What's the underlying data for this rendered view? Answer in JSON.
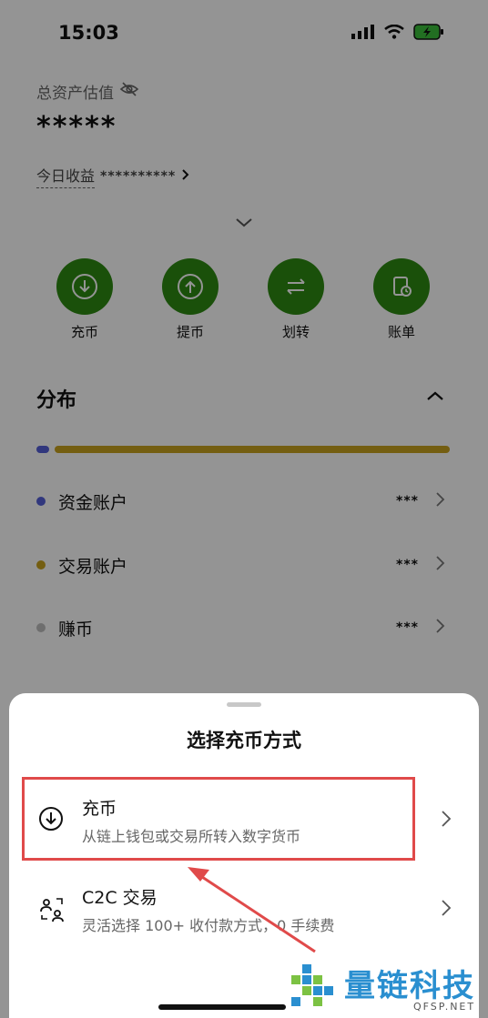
{
  "status_bar": {
    "time": "15:03"
  },
  "header": {
    "asset_label": "总资产估值",
    "asset_value": "*****",
    "today_label": "今日收益",
    "today_value": "**********"
  },
  "actions": [
    {
      "label": "充币",
      "icon": "download-icon"
    },
    {
      "label": "提币",
      "icon": "upload-icon"
    },
    {
      "label": "划转",
      "icon": "transfer-icon"
    },
    {
      "label": "账单",
      "icon": "bill-icon"
    }
  ],
  "distribution": {
    "title": "分布",
    "accounts": [
      {
        "name": "资金账户",
        "value": "***",
        "color": "#5560d8"
      },
      {
        "name": "交易账户",
        "value": "***",
        "color": "#c9a21e"
      },
      {
        "name": "赚币",
        "value": "***",
        "color": "#bdbdbd"
      }
    ]
  },
  "sheet": {
    "title": "选择充币方式",
    "options": [
      {
        "title": "充币",
        "subtitle": "从链上钱包或交易所转入数字货币",
        "icon": "download-icon"
      },
      {
        "title": "C2C 交易",
        "subtitle": "灵活选择 100+ 收付款方式，0 手续费",
        "icon": "c2c-icon"
      }
    ]
  },
  "watermark": {
    "text": "量链科技",
    "sub": "QFSP.NET"
  },
  "colors": {
    "accent": "#2d8a12",
    "highlight": "#e04a4a"
  }
}
